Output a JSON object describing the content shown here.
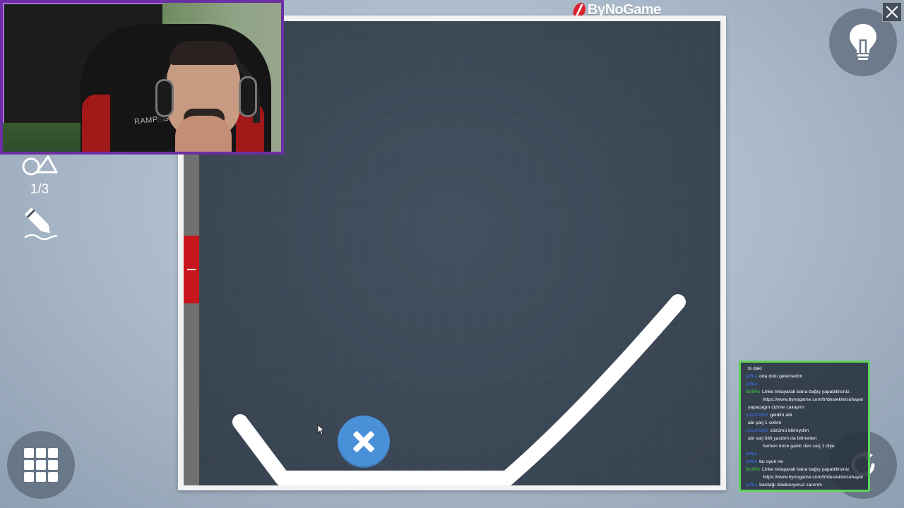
{
  "brand": {
    "name": "ByNoGame"
  },
  "hud": {
    "shape_counter": "1/3"
  },
  "webcam": {
    "chair_brand": "RAMPAGE"
  },
  "chat": {
    "messages": [
      {
        "user": "",
        "user_color": "#d02020",
        "text": "bi daki",
        "cont": ""
      },
      {
        "user": "jeffka",
        "user_color": "#3a6ee8",
        "text": "oda dolu gelemedim",
        "cont": ""
      },
      {
        "user": "jeffka",
        "user_color": "#3a6ee8",
        "text": "",
        "cont": ""
      },
      {
        "user": "BotRix",
        "user_color": "#3ad13a",
        "text": "Linke tıklayarak bana bağış yapabilirsiniz.",
        "cont": "https://www.bynogame.com/tr/destekle/suhayar"
      },
      {
        "user": "",
        "user_color": "#d02020",
        "text": "yapacagın cizime cakayım",
        "cont": ""
      },
      {
        "user": "yusuf2366",
        "user_color": "#3a6ee8",
        "text": "geldim abi",
        "cont": ""
      },
      {
        "user": "",
        "user_color": "#3a6ee8",
        "text": "abi şarj 1 cıktım",
        "cont": ""
      },
      {
        "user": "yusuf2366",
        "user_color": "#3a6ee8",
        "text": "sözümü bitireydim",
        "cont": ""
      },
      {
        "user": "",
        "user_color": "#3a6ee8",
        "text": "abi sarj bitti yazdım da bitmeden",
        "cont": "hemen önce garlic den sarj 1 diye"
      },
      {
        "user": "jeffka",
        "user_color": "#3a6ee8",
        "text": "",
        "cont": ""
      },
      {
        "user": "jeffka",
        "user_color": "#3a6ee8",
        "text": "bu oyun ne",
        "cont": ""
      },
      {
        "user": "BotRix",
        "user_color": "#3ad13a",
        "text": "Linke tıklayarak bana bağış yapabilirsiniz.",
        "cont": "https://www.bynogame.com/tr/destekle/suhayar"
      },
      {
        "user": "jeffka",
        "user_color": "#3a6ee8",
        "text": "bardağı dolduruyoruz sanırım",
        "cont": ""
      }
    ]
  },
  "colors": {
    "board": "#3c4757",
    "ball": "#4a90d9",
    "stroke": "#ffffff",
    "strip_red": "#c8161d",
    "webcam_border": "#6b2fa3",
    "chat_border": "#5fd35a"
  },
  "icons": {
    "hud_shapes": "shapes-icon",
    "hud_pencil": "pencil-icon",
    "menu": "grid-menu-icon",
    "hint": "lightbulb-icon",
    "close": "close-icon",
    "restart": "restart-icon",
    "ball": "plus-icon"
  }
}
